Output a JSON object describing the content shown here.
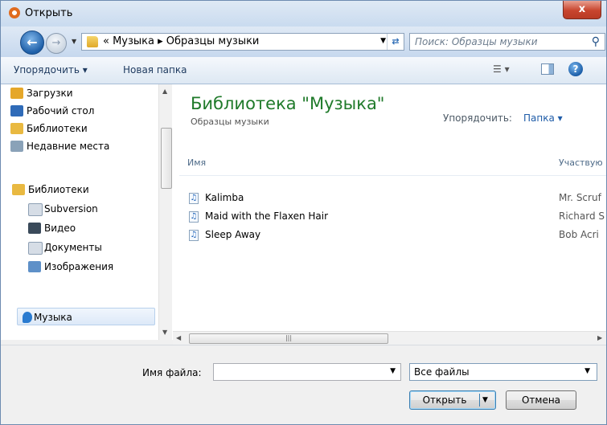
{
  "window": {
    "title": "Открыть",
    "close_label": "x"
  },
  "address": {
    "path": "« Музыка ▸ Образцы музыки",
    "search_placeholder": "Поиск: Образцы музыки"
  },
  "toolbar": {
    "organize": "Упорядочить ▾",
    "new_folder": "Новая папка"
  },
  "sidebar": {
    "items": [
      {
        "label": "Загрузки",
        "icon": "downloads-folder-icon",
        "color": "#e5a72a"
      },
      {
        "label": "Рабочий стол",
        "icon": "desktop-icon",
        "color": "#2f6bb8"
      },
      {
        "label": "Библиотеки",
        "icon": "libraries-icon",
        "color": "#e9b941"
      },
      {
        "label": "Недавние места",
        "icon": "recent-places-icon",
        "color": "#8aa2b8"
      },
      {
        "label": "Библиотеки",
        "icon": "libraries-icon",
        "color": "#e9b941"
      },
      {
        "label": "Subversion",
        "icon": "document-icon",
        "color": "#d6dde6"
      },
      {
        "label": "Видео",
        "icon": "video-icon",
        "color": "#3a4a5a"
      },
      {
        "label": "Документы",
        "icon": "documents-icon",
        "color": "#d6dde6"
      },
      {
        "label": "Изображения",
        "icon": "pictures-icon",
        "color": "#5e90c8"
      },
      {
        "label": "Музыка",
        "icon": "music-icon",
        "color": "#2a7bd0",
        "selected": true
      }
    ]
  },
  "library": {
    "title": "Библиотека \"Музыка\"",
    "subtitle": "Образцы музыки",
    "arrange_label": "Упорядочить:",
    "arrange_value": "Папка ▾"
  },
  "columns": {
    "name": "Имя",
    "participants": "Участвую"
  },
  "files": [
    {
      "name": "Kalimba",
      "artist": "Mr. Scruf"
    },
    {
      "name": "Maid with the Flaxen Hair",
      "artist": "Richard S"
    },
    {
      "name": "Sleep Away",
      "artist": "Bob Acri"
    }
  ],
  "bottom": {
    "filename_label": "Имя файла:",
    "filename_value": "",
    "filetype": "Все файлы",
    "open_button": "Открыть",
    "cancel_button": "Отмена"
  }
}
